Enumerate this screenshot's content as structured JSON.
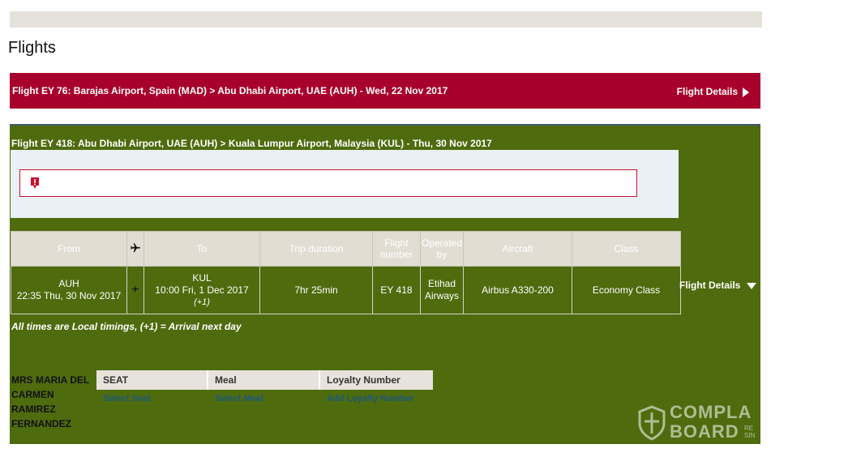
{
  "page": {
    "title": "Flights"
  },
  "flight1": {
    "route": "Flight  EY 76:  Barajas Airport, Spain (MAD)  >  Abu Dhabi Airport, UAE (AUH)  - Wed, 22 Nov 2017",
    "details_label": "Flight Details",
    "bg_color": "#a8002c"
  },
  "flight2": {
    "route": "Flight  EY 418:  Abu Dhabi Airport, UAE (AUH)  >  Kuala Lumpur Airport, Malaysia (KUL)  - Thu, 30 Nov 2017",
    "details_label": "Flight Details",
    "bg_color": "#4e6b0e",
    "alert_icon": "alert-icon",
    "alert_message": "",
    "table": {
      "headers": {
        "from": "From",
        "to": "To",
        "duration": "Trip duration",
        "flight_number": "Flight number",
        "operated_by": "Operated by",
        "aircraft": "Aircraft",
        "class": "Class"
      },
      "row": {
        "from_code": "AUH",
        "from_time": "22:35 Thu, 30 Nov 2017",
        "to_code": "KUL",
        "to_time": "10:00 Fri, 1 Dec 2017",
        "to_next_day": "(+1)",
        "duration": "7hr 25min",
        "flight_number": "EY 418",
        "operated_by": "Etihad Airways",
        "aircraft": "Airbus A330-200",
        "class": "Economy Class"
      }
    },
    "note": "All times are Local timings, (+1) = Arrival next day"
  },
  "passenger": {
    "name": "MRS MARIA DEL CARMEN RAMIREZ FERNANDEZ",
    "columns": {
      "seat": "SEAT",
      "meal": "Meal",
      "loyalty": "Loyalty Number"
    },
    "links": {
      "seat": "Select Seat",
      "meal": "Select Meal",
      "loyalty": "Add Loyalty Number"
    }
  },
  "watermark": {
    "line1": "COMPLA",
    "line2": "BOARD",
    "small1": "RE",
    "small2": "SIN"
  }
}
